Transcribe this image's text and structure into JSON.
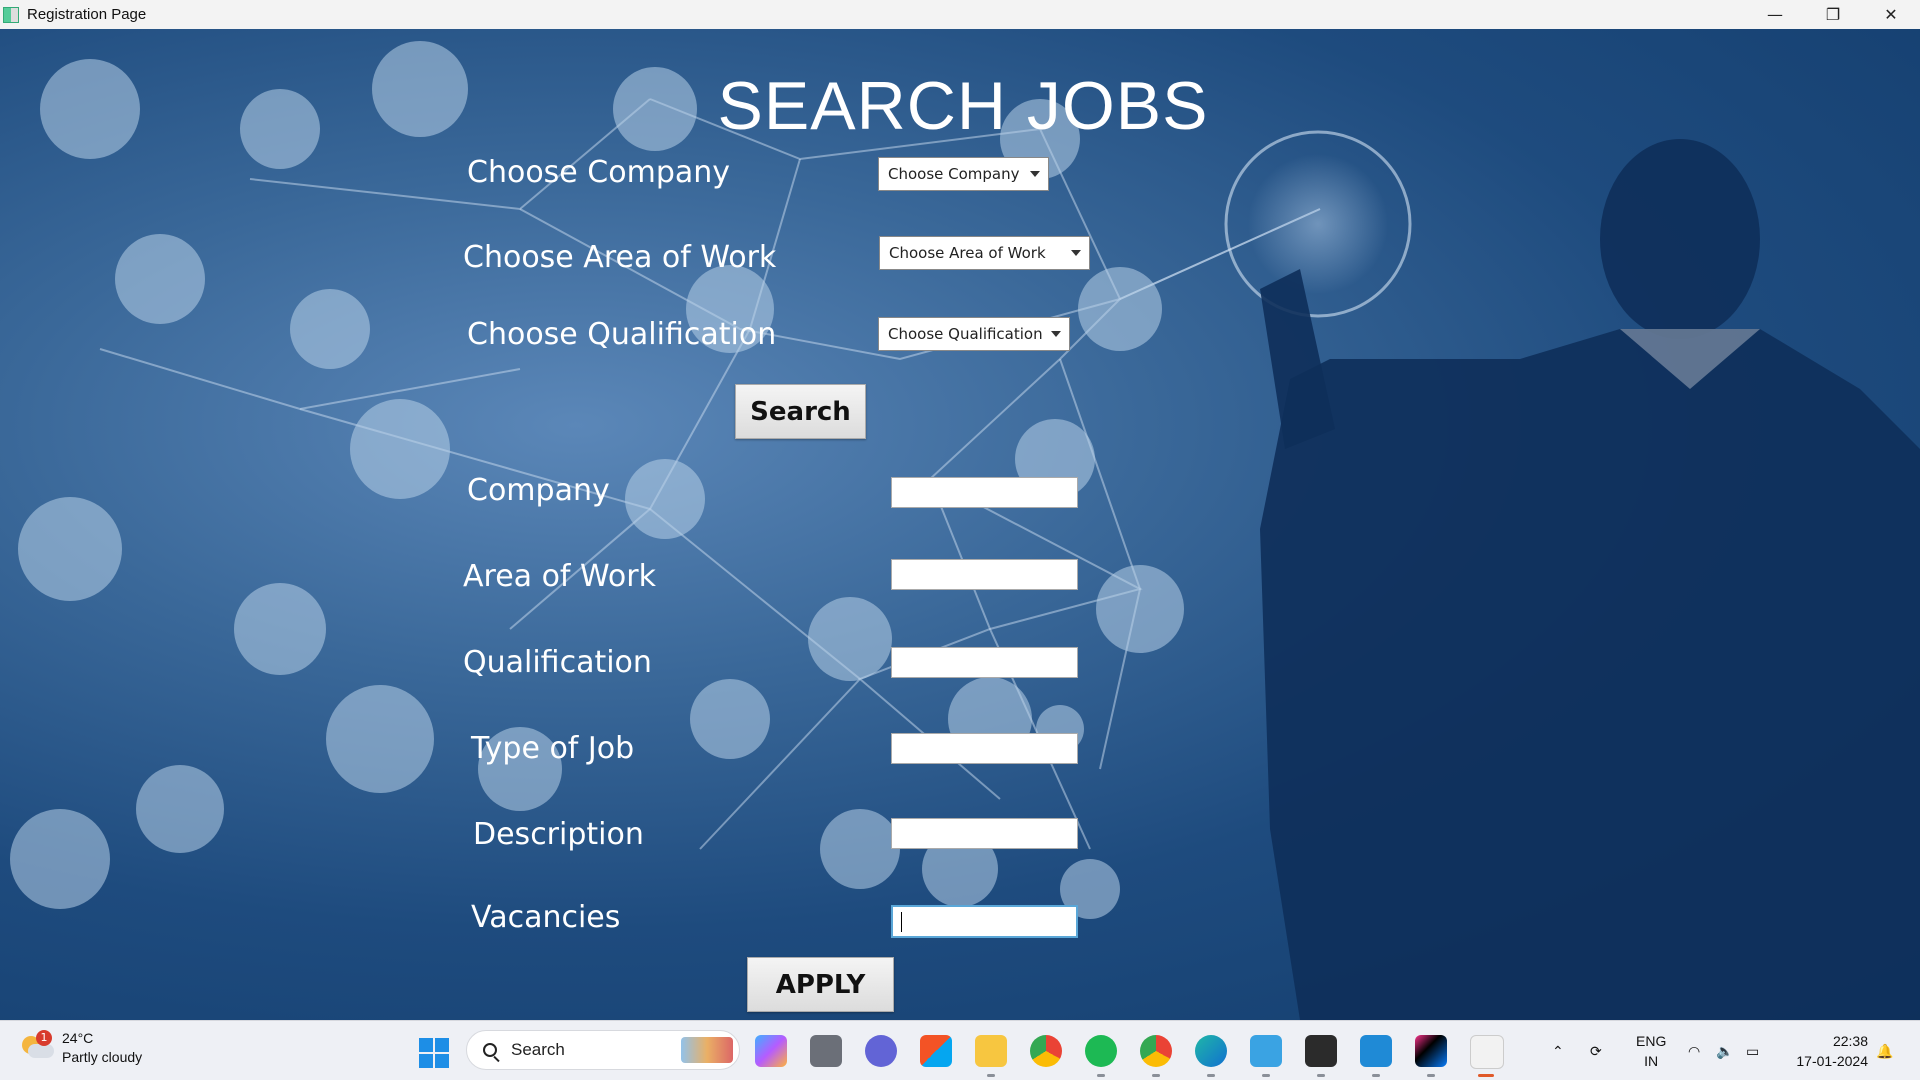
{
  "window": {
    "title": "Registration Page",
    "controls": {
      "minimize": "—",
      "restore": "❐",
      "close": "✕"
    }
  },
  "heading": "SEARCH JOBS",
  "filters": {
    "company_label": "Choose Company",
    "company_value": "Choose Company",
    "area_label": "Choose Area of Work",
    "area_value": "Choose Area of Work",
    "qualification_label": "Choose Qualification",
    "qualification_value": "Choose Qualification"
  },
  "search_button": "Search",
  "results": {
    "company_label": "Company",
    "area_label": "Area of Work",
    "qualification_label": "Qualification",
    "type_label": "Type of Job",
    "description_label": "Description",
    "vacancies_label": "Vacancies",
    "company_value": "",
    "area_value": "",
    "qualification_value": "",
    "type_value": "",
    "description_value": "",
    "vacancies_value": ""
  },
  "apply_button": "APPLY",
  "taskbar": {
    "weather_temp": "24°C",
    "weather_desc": "Partly cloudy",
    "weather_badge": "1",
    "search_placeholder": "Search",
    "lang_line1": "ENG",
    "lang_line2": "IN",
    "time": "22:38",
    "date": "17-01-2024",
    "icons": [
      "copilot-icon",
      "task-view-icon",
      "teams-chat-icon",
      "ms-store-icon",
      "file-explorer-icon",
      "chrome-icon",
      "spotify-icon",
      "chrome-profile-icon",
      "edge-icon",
      "notepad-icon",
      "terminal-icon",
      "vscode-icon",
      "intellij-icon",
      "java-app-icon"
    ]
  },
  "colors": {
    "background": "#1e4b7e",
    "taskbar": "#eef0f5",
    "focus_border": "#5aa7d8"
  }
}
